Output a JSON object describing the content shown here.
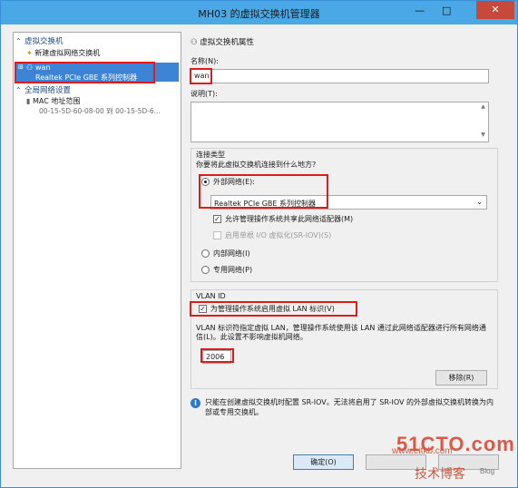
{
  "window": {
    "title": "MH03 的虚拟交换机管理器",
    "minimize": "—",
    "maximize": "□",
    "close": "✕"
  },
  "sidebar": {
    "section_switches": "虚拟交换机",
    "new_switch": "新建虚拟网络交换机",
    "selected_switch": {
      "name": "wan",
      "adapter": "Realtek PCIe GBE 系列控制器"
    },
    "section_global": "全局网络设置",
    "mac_range": {
      "label": "MAC 地址范围",
      "value": "00-15-5D-60-08-00 到 00-15-5D-6..."
    }
  },
  "properties": {
    "heading": "虚拟交换机属性",
    "name_label": "名称(N):",
    "name_value": "wan",
    "notes_label": "说明(T):",
    "notes_value": "",
    "connection_type": {
      "title": "连接类型",
      "question": "你要将此虚拟交换机连接到什么地方?",
      "external_label": "外部网络(E):",
      "adapter_value": "Realtek PCIe GBE 系列控制器",
      "allow_mgmt_label": "允许管理操作系统共享此网络适配器(M)",
      "sriov_label": "启用单根 I/O 虚拟化(SR-IOV)(S)",
      "internal_label": "内部网络(I)",
      "private_label": "专用网络(P)"
    },
    "vlan": {
      "title": "VLAN ID",
      "enable_label": "为管理操作系统启用虚拟 LAN 标识(V)",
      "description": "VLAN 标识符指定虚拟 LAN，管理操作系统使用该 LAN 通过此网络适配器进行所有网络通信(L)。此设置不影响虚拟机网络。",
      "id_value": "2006"
    },
    "remove_button": "移除(R)",
    "info_text": "只能在创建虚拟交换机时配置 SR-IOV。无法将启用了 SR-IOV 的外部虚拟交换机转换为内部或专用交换机。"
  },
  "footer": {
    "ok_button": "确定(O)"
  },
  "watermark": {
    "line1": "51CTO.com",
    "line2": "www.eitkb.com",
    "line3": "技术博客",
    "line4": "Blog"
  },
  "colors": {
    "titlebar": "#4aa8e6",
    "selection": "#3d84d6",
    "highlight_box": "#e11a1a",
    "close_button": "#c7493b"
  }
}
